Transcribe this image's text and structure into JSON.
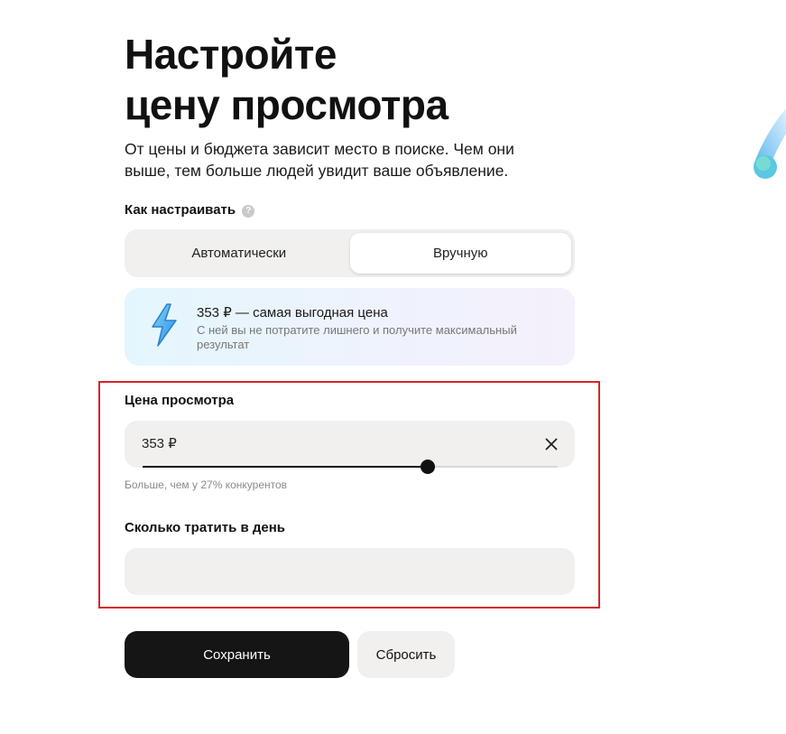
{
  "header": {
    "title_line1": "Настройте",
    "title_line2": "цену просмотра",
    "subtitle": "От цены и бюджета зависит место в поиске. Чем они выше, тем больше людей увидит ваше объявление."
  },
  "mode": {
    "label": "Как настраивать",
    "help_glyph": "?",
    "options": [
      {
        "label": "Автоматически",
        "active": false
      },
      {
        "label": "Вручную",
        "active": true
      }
    ]
  },
  "promo": {
    "icon": "lightning-icon",
    "title": "353 ₽ — самая выгодная цена",
    "text": "С ней вы не потратите лишнего и получите максимальный результат"
  },
  "price": {
    "label": "Цена просмотра",
    "value": "353 ₽",
    "slider_fraction": 0.687,
    "hint": "Больше, чем у 27% конкурентов"
  },
  "budget": {
    "label": "Сколько тратить в день",
    "value": "",
    "placeholder": ""
  },
  "actions": {
    "save_label": "Сохранить",
    "reset_label": "Сбросить"
  },
  "colors": {
    "accent_dark": "#151515",
    "field_bg": "#f1f0ee",
    "highlight_border": "#d9232a",
    "promo_icon": "#3fa3e8"
  }
}
